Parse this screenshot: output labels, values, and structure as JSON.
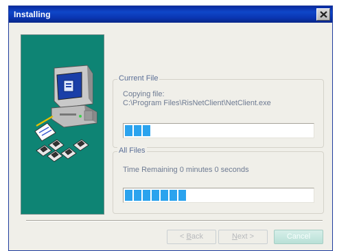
{
  "window": {
    "title": "Installing"
  },
  "current_file": {
    "legend": "Current File",
    "line1": "Copying file:",
    "line2": "C:\\Program Files\\RisNetClient\\NetClient.exe",
    "progress_fraction": 0.13
  },
  "all_files": {
    "legend": "All Files",
    "status": "Time Remaining 0 minutes 0 seconds",
    "progress_fraction": 0.31
  },
  "buttons": {
    "back_pre": "< ",
    "back_key": "B",
    "back_post": "ack",
    "next_key": "N",
    "next_post": "ext >",
    "cancel": "Cancel"
  },
  "icons": {
    "close": "close-icon",
    "illustration": "computer-install-illustration"
  },
  "colors": {
    "titlebar": "#0a36b2",
    "panel": "#0e8474",
    "progress": "#2ba3ee"
  }
}
